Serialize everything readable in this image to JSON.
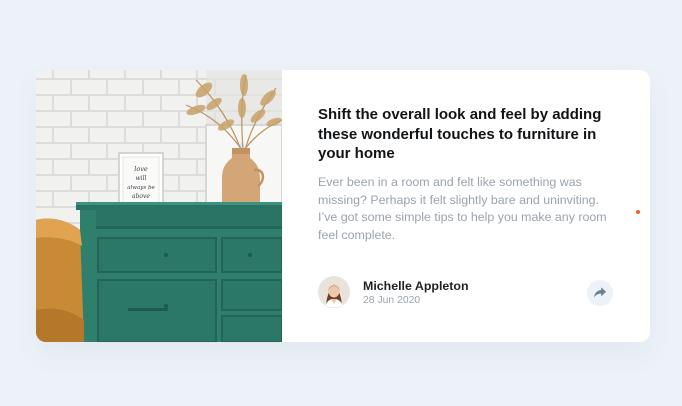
{
  "article": {
    "title": "Shift the overall look and feel by adding these wonderful touches to furniture in your home",
    "description": "Ever been in a room and felt like something was missing? Perhaps it felt slightly bare and uninviting. I’ve got some simple tips to help you make any room feel complete.",
    "image": {
      "description": "",
      "frame_text": "love will always be above"
    }
  },
  "author": {
    "name": "Michelle Appleton",
    "date": "28 Jun 2020"
  },
  "share": {
    "icon": "share-icon"
  },
  "colors": {
    "background": "#ecf2f8",
    "title": "#111417",
    "body_text": "#9aa3ad",
    "dresser": "#2f7f6d",
    "accent_dot": "#e8612d"
  }
}
